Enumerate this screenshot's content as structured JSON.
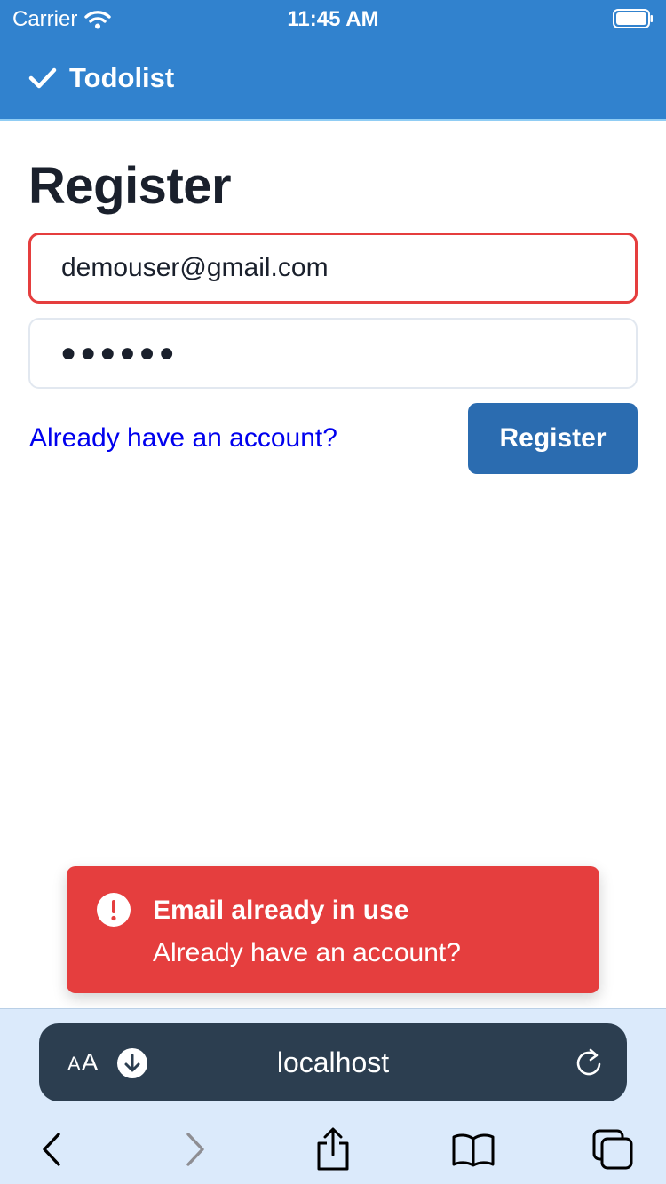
{
  "status_bar": {
    "carrier": "Carrier",
    "time": "11:45 AM"
  },
  "app": {
    "brand": "Todolist"
  },
  "page": {
    "title": "Register"
  },
  "form": {
    "email_value": "demouser@gmail.com",
    "password_mask": "●●●●●●",
    "login_link": "Already have an account?",
    "submit_label": "Register"
  },
  "toast": {
    "title": "Email already in use",
    "description": "Already have an account?"
  },
  "browser": {
    "aa_small": "A",
    "aa_large": "A",
    "url": "localhost",
    "icons": [
      "download-icon",
      "reload-icon",
      "back-icon",
      "forward-icon",
      "share-icon",
      "bookmarks-icon",
      "tabs-icon"
    ]
  },
  "colors": {
    "header": "#3182ce",
    "primary_button": "#2b6cb0",
    "error": "#e53e3e",
    "link": "#0000ee",
    "url_bar": "#2c3e50",
    "browser_chrome": "#dbeafb"
  }
}
